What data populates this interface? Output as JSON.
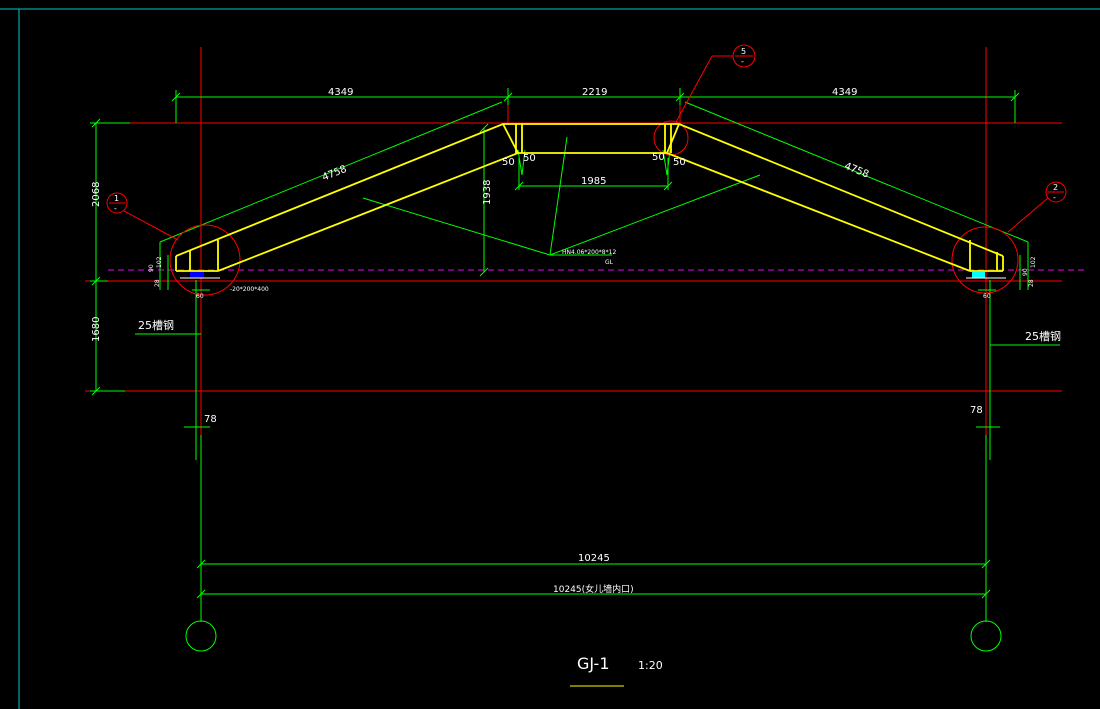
{
  "drawing": {
    "title": "GJ-1",
    "scale": "1:20",
    "colors": {
      "background": "#000000",
      "frame": "#00c8c8",
      "axis_line": "#ff0000",
      "dimension": "#00ff00",
      "member": "#ffff00",
      "ground": "#c000c0",
      "text": "#ffffff"
    }
  },
  "dimensions": {
    "top_left": "4349",
    "top_mid": "2219",
    "top_right": "4349",
    "rafter_left": "4758",
    "rafter_right": "4758",
    "ridge_inner": "1985",
    "height_center": "1938",
    "height_upper": "2068",
    "height_lower": "1680",
    "offset_left": "78",
    "offset_right": "78",
    "span": "10245",
    "span_note": "10245(女儿墙内口)",
    "joint_left_a": "50",
    "joint_left_b": "50",
    "joint_right_a": "50",
    "joint_right_b": "50"
  },
  "annotations": {
    "member_spec": "HN4.06*200*8*12",
    "member_spec_sub": "GL",
    "plate_note": "-20*200*400",
    "channel_left": "25槽钢",
    "channel_right": "25槽钢",
    "small_left": [
      "102",
      "90",
      "28",
      "60"
    ],
    "small_right": [
      "102",
      "90",
      "28",
      "60"
    ]
  },
  "bubbles": {
    "left": {
      "num": "1",
      "sub": "-"
    },
    "right": {
      "num": "2",
      "sub": "-"
    },
    "ridge": {
      "num": "5",
      "sub": "-"
    }
  }
}
